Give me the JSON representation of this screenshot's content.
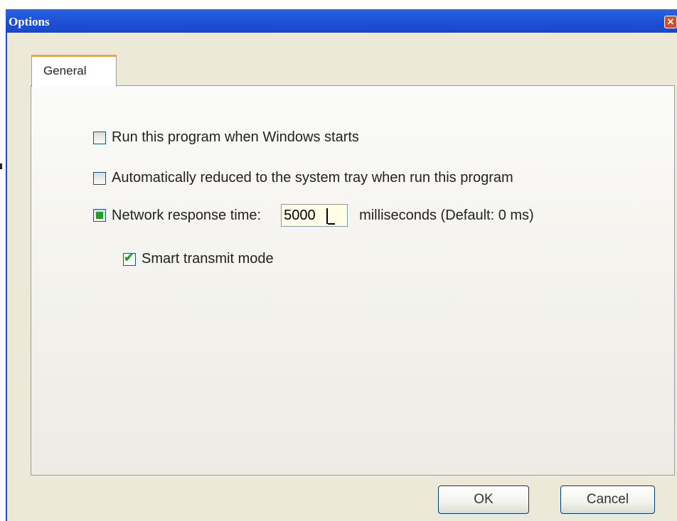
{
  "window": {
    "title": "Options",
    "close_glyph": "✕"
  },
  "tabs": [
    {
      "label": "General",
      "active": true
    }
  ],
  "options": {
    "run_on_startup": {
      "label": "Run this program when Windows starts",
      "checked": false
    },
    "minimize_to_tray": {
      "label": "Automatically reduced to the system tray when run this program",
      "checked": false
    },
    "network_response": {
      "label": "Network response time:",
      "value": "5000",
      "unit_text": "milliseconds (Default: 0 ms)",
      "state": "indeterminate"
    },
    "smart_transmit": {
      "label": "Smart transmit mode",
      "checked": true
    }
  },
  "buttons": {
    "ok": "OK",
    "cancel": "Cancel"
  },
  "colors": {
    "titlebar": "#2a63e8",
    "tab_accent": "#f0a626",
    "check_green": "#21a121",
    "panel_bg": "#ece9d8"
  }
}
